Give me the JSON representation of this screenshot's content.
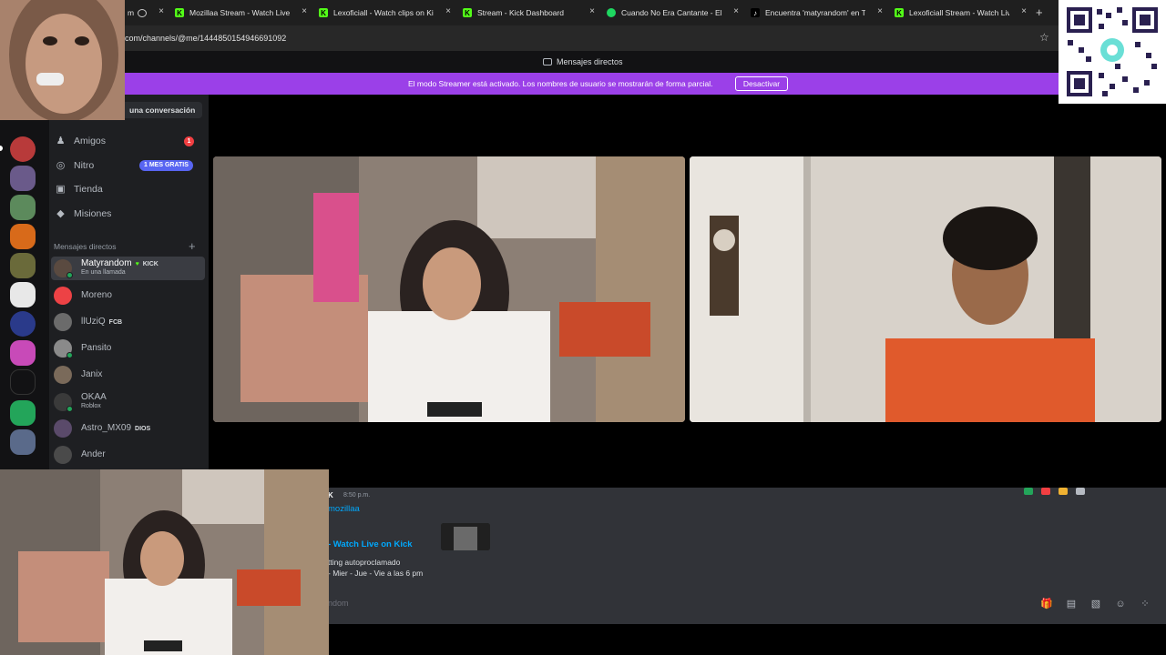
{
  "browser": {
    "tabs": [
      {
        "title": "m",
        "favicon": "obs-icon"
      },
      {
        "title": "Mozillaa Stream - Watch Live on Kick",
        "favicon": "kick-icon"
      },
      {
        "title": "Lexoficiall - Watch clips on Kick",
        "favicon": "kick-icon"
      },
      {
        "title": "Stream - Kick Dashboard",
        "favicon": "kick-icon"
      },
      {
        "title": "Cuando No Era Cantante - El Bi",
        "favicon": "spotify-icon"
      },
      {
        "title": "Encuentra 'matyrandom' en Tik",
        "favicon": "tiktok-icon"
      },
      {
        "title": "Lexoficiall Stream - Watch Live",
        "favicon": "kick-icon"
      }
    ],
    "close_glyph": "×",
    "new_tab_glyph": "+",
    "url": "com/channels/@me/1444850154946691092",
    "bookmark_glyph": "☆"
  },
  "discord": {
    "top_title": "Mensajes directos",
    "streamer_banner": {
      "text": "El modo Streamer está activado. Los nombres de usuario se mostrarán de forma parcial.",
      "button": "Desactivar"
    },
    "find_conversation": "una conversación",
    "nav": [
      {
        "label": "Amigos",
        "icon": "friends-icon",
        "glyph": "♟",
        "badge": "1"
      },
      {
        "label": "Nitro",
        "icon": "nitro-icon",
        "glyph": "◎",
        "badge": "1 MES GRATIS"
      },
      {
        "label": "Tienda",
        "icon": "shop-icon",
        "glyph": "▣",
        "badge": ""
      },
      {
        "label": "Misiones",
        "icon": "quests-icon",
        "glyph": "◆",
        "badge": ""
      }
    ],
    "dm_header": "Mensajes directos",
    "dm_add_glyph": "+",
    "dms": [
      {
        "name": "Matyrandom",
        "tag": "KICK",
        "sub": "En una llamada",
        "color": "#5a4a40"
      },
      {
        "name": "Moreno",
        "tag": "",
        "sub": "",
        "color": "#ed4245"
      },
      {
        "name": "llUziQ",
        "tag": "FCB",
        "sub": "",
        "color": "#6b6b6b"
      },
      {
        "name": "Pansito",
        "tag": "",
        "sub": "",
        "color": "#8a8a8a"
      },
      {
        "name": "Janix",
        "tag": "",
        "sub": "",
        "color": "#7a6a5a"
      },
      {
        "name": "OKAA",
        "tag": "",
        "sub": "Roblox",
        "color": "#3a3a3a"
      },
      {
        "name": "Astro_MX09",
        "tag": "DIOS",
        "sub": "",
        "color": "#5a4a6a"
      },
      {
        "name": "Ander",
        "tag": "",
        "sub": "",
        "color": "#4a4a4a"
      }
    ]
  },
  "chat": {
    "author": "K",
    "time": "8:50 p.m.",
    "link_text": "mozillaa",
    "embed_title": "- Watch Live on Kick",
    "embed_desc_line1": "tting autoproclamado",
    "embed_desc_line2": "- Mier - Jue - Vie a las 6 pm",
    "input_placeholder": "ndom",
    "tool_icons": [
      "gift-icon",
      "gif-icon",
      "sticker-icon",
      "emoji-icon",
      "apps-icon"
    ],
    "tool_glyphs": [
      "🎁",
      "▤",
      "▧",
      "☺",
      "⁘"
    ],
    "reaction_colors": [
      "#23a55a",
      "#f23f42",
      "#f0b232",
      "#b5bac1"
    ]
  },
  "colors": {
    "streamer_purple": "#9b40e8",
    "discord_dark": "#1e1f22",
    "kick_green": "#53fc18"
  }
}
